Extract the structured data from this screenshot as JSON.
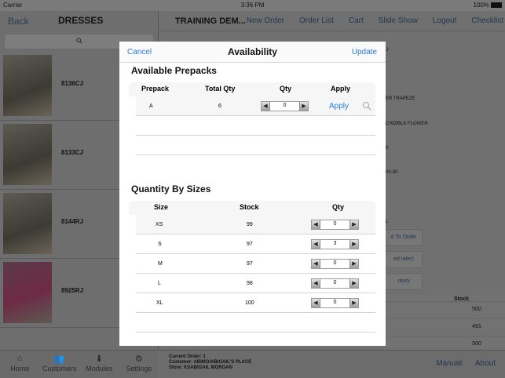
{
  "status": {
    "carrier": "Carrier",
    "time": "3:36 PM",
    "battery": "100%"
  },
  "left": {
    "back": "Back",
    "title": "DRESSES",
    "items": [
      {
        "label": "8136CJ"
      },
      {
        "label": "8133CJ"
      },
      {
        "label": "8144RJ"
      },
      {
        "label": "8925RJ"
      }
    ],
    "tabs": [
      {
        "label": "Home",
        "icon": "home-icon"
      },
      {
        "label": "Customers",
        "icon": "customers-icon"
      },
      {
        "label": "Modules",
        "icon": "modules-icon"
      },
      {
        "label": "Settings",
        "icon": "settings-icon"
      }
    ]
  },
  "main": {
    "title": "TRAINING DEM...",
    "nav": [
      "New Order",
      "Order List",
      "Cart",
      "Slide Show",
      "Logout",
      "Checklist"
    ],
    "fragments": [
      "J",
      "ER TRAPEZE",
      "CHO/BLK FLOWER",
      "0",
      "03-30",
      "L"
    ],
    "buttons": [
      "d To Order",
      "ed later)",
      "ntory"
    ],
    "stock_header": "Stock",
    "stock_values": [
      "500",
      "491",
      "500"
    ]
  },
  "footer": {
    "current_order": "Current Order: 1",
    "customer": "Customer: ABIMO/ABIGAIL'S PLACE",
    "store": "Store: 01/ABIGAIL MORGAN",
    "links": [
      "Manual",
      "About"
    ]
  },
  "modal": {
    "cancel": "Cancel",
    "title": "Availability",
    "update": "Update",
    "prepacks": {
      "title": "Available Prepacks",
      "headers": [
        "Prepack",
        "Total Qty",
        "Qty",
        "Apply"
      ],
      "rows": [
        {
          "prepack": "A",
          "total": "6",
          "qty": "0",
          "apply": "Apply"
        }
      ]
    },
    "sizes": {
      "title": "Quantity By Sizes",
      "headers": [
        "Size",
        "Stock",
        "Qty"
      ],
      "rows": [
        {
          "size": "XS",
          "stock": "99",
          "qty": "0"
        },
        {
          "size": "S",
          "stock": "97",
          "qty": "3"
        },
        {
          "size": "M",
          "stock": "97",
          "qty": "0"
        },
        {
          "size": "L",
          "stock": "98",
          "qty": "0"
        },
        {
          "size": "XL",
          "stock": "100",
          "qty": "0"
        }
      ]
    }
  }
}
